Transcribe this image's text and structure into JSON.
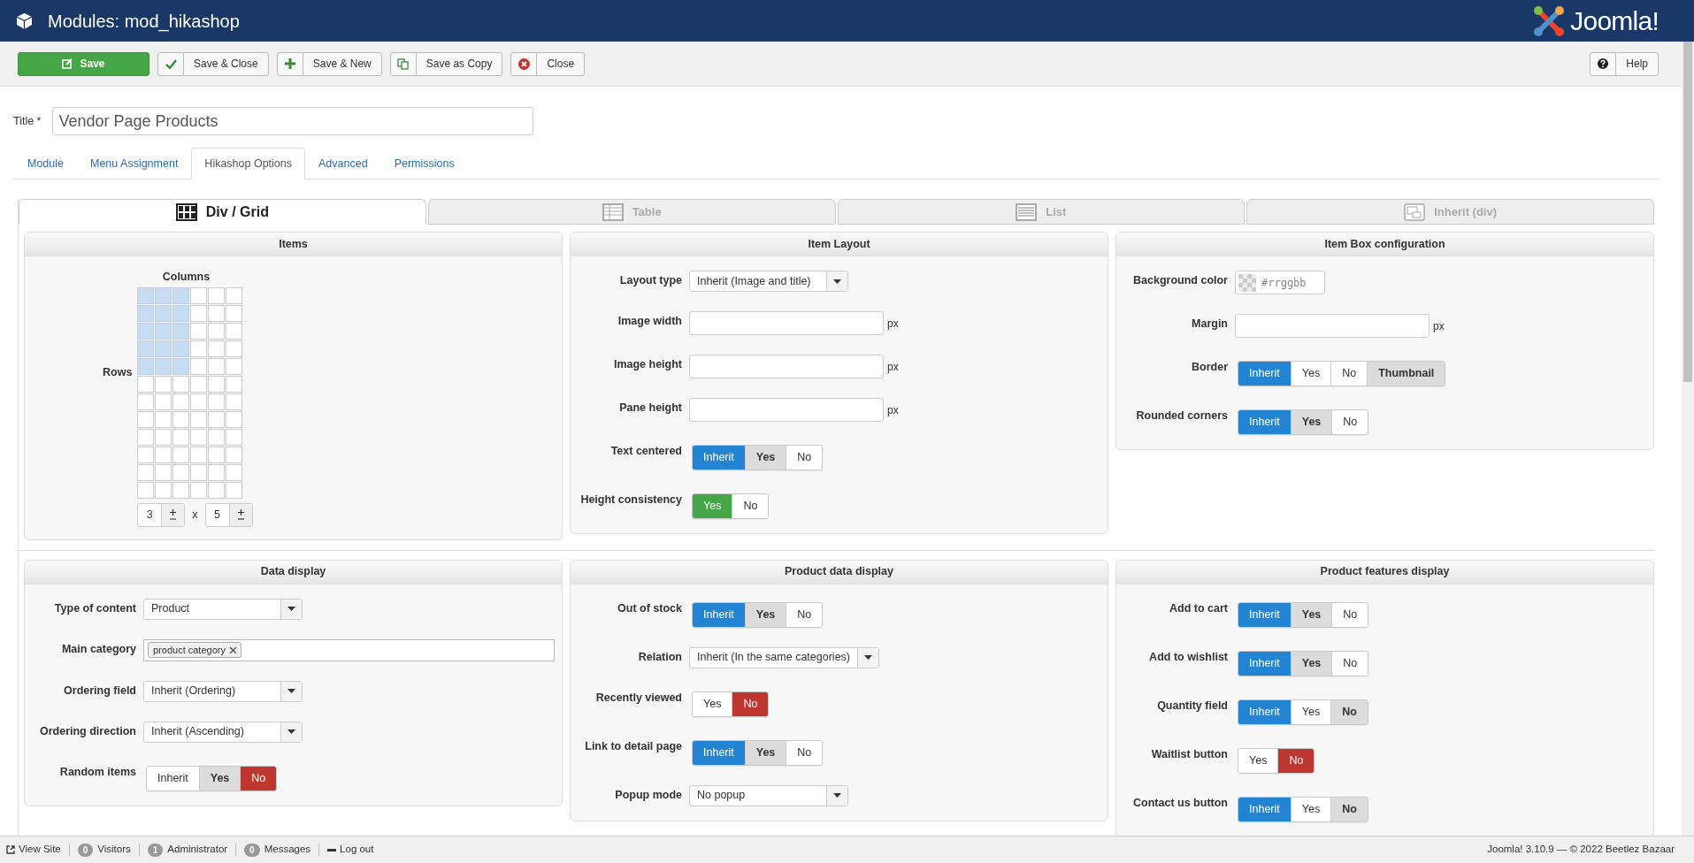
{
  "header": {
    "title": "Modules: mod_hikashop",
    "logo_text": "Joomla!"
  },
  "toolbar": {
    "buttons": [
      {
        "label": "Save",
        "kind": "save"
      },
      {
        "label": "Save & Close",
        "kind": "check"
      },
      {
        "label": "Save & New",
        "kind": "plus"
      },
      {
        "label": "Save as Copy",
        "kind": "copy"
      },
      {
        "label": "Close",
        "kind": "close"
      }
    ],
    "help": "Help"
  },
  "title_field": {
    "label": "Title *",
    "value": "Vendor Page Products"
  },
  "tabs": [
    {
      "label": "Module",
      "selected": false
    },
    {
      "label": "Menu Assignment",
      "selected": false
    },
    {
      "label": "Hikashop Options",
      "selected": true
    },
    {
      "label": "Advanced",
      "selected": false
    },
    {
      "label": "Permissions",
      "selected": false
    }
  ],
  "layout_tabs": [
    {
      "label": "Div / Grid",
      "kind": "grid",
      "selected": true
    },
    {
      "label": "Table",
      "kind": "table",
      "selected": false
    },
    {
      "label": "List",
      "kind": "list",
      "selected": false
    },
    {
      "label": "Inherit (div)",
      "kind": "inherit",
      "selected": false
    }
  ],
  "panels": [
    {
      "title": "Items",
      "kind": "grid",
      "columns_label": "Columns",
      "rows_label": "Rows",
      "columns": "3",
      "rows": "5",
      "separator": "x"
    },
    {
      "title": "Item Layout",
      "kind": "form",
      "fields": [
        {
          "label": "Layout type",
          "kind": "select",
          "value": "Inherit (Image and title)"
        },
        {
          "label": "Image width",
          "kind": "text",
          "unit": "px"
        },
        {
          "label": "Image height",
          "kind": "text",
          "unit": "px"
        },
        {
          "label": "Pane height",
          "kind": "text",
          "unit": "px"
        },
        {
          "label": "Text centered",
          "kind": "toggle",
          "options": [
            {
              "label": "Inherit",
              "kind": "inherit",
              "selected": true,
              "implied": false
            },
            {
              "label": "Yes",
              "kind": "yes",
              "selected": false,
              "implied": true
            },
            {
              "label": "No",
              "kind": "no",
              "selected": false,
              "implied": false
            }
          ]
        },
        {
          "label": "Height consistency",
          "kind": "toggle",
          "options": [
            {
              "label": "Yes",
              "kind": "yes",
              "selected": true,
              "implied": false
            },
            {
              "label": "No",
              "kind": "no",
              "selected": false,
              "implied": false
            }
          ]
        }
      ]
    },
    {
      "title": "Item Box configuration",
      "kind": "form",
      "fields": [
        {
          "label": "Background color",
          "kind": "color",
          "placeholder": "#rrggbb"
        },
        {
          "label": "Margin",
          "kind": "text",
          "unit": "px"
        },
        {
          "label": "Border",
          "kind": "toggle",
          "options": [
            {
              "label": "Inherit",
              "kind": "inherit",
              "selected": true,
              "implied": false
            },
            {
              "label": "Yes",
              "kind": "yes",
              "selected": false,
              "implied": false
            },
            {
              "label": "No",
              "kind": "no",
              "selected": false,
              "implied": false
            },
            {
              "label": "Thumbnail",
              "kind": "other",
              "selected": false,
              "implied": true
            }
          ]
        },
        {
          "label": "Rounded corners",
          "kind": "toggle",
          "options": [
            {
              "label": "Inherit",
              "kind": "inherit",
              "selected": true,
              "implied": false
            },
            {
              "label": "Yes",
              "kind": "yes",
              "selected": false,
              "implied": true
            },
            {
              "label": "No",
              "kind": "no",
              "selected": false,
              "implied": false
            }
          ]
        }
      ]
    },
    {
      "title": "Data display",
      "kind": "form",
      "fields": [
        {
          "label": "Type of content",
          "kind": "select",
          "value": "Product"
        },
        {
          "label": "Main category",
          "kind": "tags",
          "tags": [
            "product category"
          ]
        },
        {
          "label": "Ordering field",
          "kind": "select",
          "value": "Inherit (Ordering)"
        },
        {
          "label": "Ordering direction",
          "kind": "select",
          "value": "Inherit (Ascending)"
        },
        {
          "label": "Random items",
          "kind": "toggle",
          "options": [
            {
              "label": "Inherit",
              "kind": "inherit",
              "selected": false,
              "implied": false
            },
            {
              "label": "Yes",
              "kind": "yes",
              "selected": false,
              "implied": true
            },
            {
              "label": "No",
              "kind": "no",
              "selected": true,
              "implied": false
            }
          ]
        }
      ]
    },
    {
      "title": "Product data display",
      "kind": "form",
      "fields": [
        {
          "label": "Out of stock",
          "kind": "toggle",
          "options": [
            {
              "label": "Inherit",
              "kind": "inherit",
              "selected": true,
              "implied": false
            },
            {
              "label": "Yes",
              "kind": "yes",
              "selected": false,
              "implied": true
            },
            {
              "label": "No",
              "kind": "no",
              "selected": false,
              "implied": false
            }
          ]
        },
        {
          "label": "Relation",
          "kind": "select",
          "value": "Inherit (In the same categories)"
        },
        {
          "label": "Recently viewed",
          "kind": "toggle",
          "options": [
            {
              "label": "Yes",
              "kind": "yes",
              "selected": false,
              "implied": false
            },
            {
              "label": "No",
              "kind": "no",
              "selected": true,
              "implied": false
            }
          ]
        },
        {
          "label": "Link to detail page",
          "kind": "toggle",
          "options": [
            {
              "label": "Inherit",
              "kind": "inherit",
              "selected": true,
              "implied": false
            },
            {
              "label": "Yes",
              "kind": "yes",
              "selected": false,
              "implied": true
            },
            {
              "label": "No",
              "kind": "no",
              "selected": false,
              "implied": false
            }
          ]
        },
        {
          "label": "Popup mode",
          "kind": "select",
          "value": "No popup"
        }
      ]
    },
    {
      "title": "Product features display",
      "kind": "form",
      "fields": [
        {
          "label": "Add to cart",
          "kind": "toggle",
          "options": [
            {
              "label": "Inherit",
              "kind": "inherit",
              "selected": true,
              "implied": false
            },
            {
              "label": "Yes",
              "kind": "yes",
              "selected": false,
              "implied": true
            },
            {
              "label": "No",
              "kind": "no",
              "selected": false,
              "implied": false
            }
          ]
        },
        {
          "label": "Add to wishlist",
          "kind": "toggle",
          "options": [
            {
              "label": "Inherit",
              "kind": "inherit",
              "selected": true,
              "implied": false
            },
            {
              "label": "Yes",
              "kind": "yes",
              "selected": false,
              "implied": true
            },
            {
              "label": "No",
              "kind": "no",
              "selected": false,
              "implied": false
            }
          ]
        },
        {
          "label": "Quantity field",
          "kind": "toggle",
          "options": [
            {
              "label": "Inherit",
              "kind": "inherit",
              "selected": true,
              "implied": false
            },
            {
              "label": "Yes",
              "kind": "yes",
              "selected": false,
              "implied": false
            },
            {
              "label": "No",
              "kind": "no",
              "selected": false,
              "implied": true
            }
          ]
        },
        {
          "label": "Waitlist button",
          "kind": "toggle",
          "options": [
            {
              "label": "Yes",
              "kind": "yes",
              "selected": false,
              "implied": false
            },
            {
              "label": "No",
              "kind": "no",
              "selected": true,
              "implied": false
            }
          ]
        },
        {
          "label": "Contact us button",
          "kind": "toggle",
          "options": [
            {
              "label": "Inherit",
              "kind": "inherit",
              "selected": true,
              "implied": false
            },
            {
              "label": "Yes",
              "kind": "yes",
              "selected": false,
              "implied": false
            },
            {
              "label": "No",
              "kind": "no",
              "selected": false,
              "implied": true
            }
          ]
        }
      ]
    }
  ],
  "status_bar": {
    "items": [
      {
        "label": "View Site",
        "kind": "link"
      },
      {
        "count": "0",
        "label": "Visitors",
        "kind": "count"
      },
      {
        "count": "1",
        "label": "Administrator",
        "kind": "count"
      },
      {
        "count": "0",
        "label": "Messages",
        "kind": "count"
      },
      {
        "label": "Log out",
        "kind": "logout"
      }
    ],
    "footer": "Joomla! 3.10.9 — © 2022 Beetlez Bazaar"
  }
}
